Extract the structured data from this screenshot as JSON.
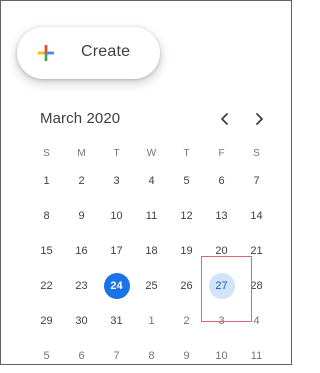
{
  "create_button": {
    "label": "Create",
    "icon": "plus-icon"
  },
  "mini_calendar": {
    "month_label": "March 2020",
    "prev_icon": "chevron-left-icon",
    "next_icon": "chevron-right-icon",
    "weekdays": [
      "S",
      "M",
      "T",
      "W",
      "T",
      "F",
      "S"
    ],
    "weeks": [
      [
        {
          "d": "1"
        },
        {
          "d": "2"
        },
        {
          "d": "3"
        },
        {
          "d": "4"
        },
        {
          "d": "5"
        },
        {
          "d": "6"
        },
        {
          "d": "7"
        }
      ],
      [
        {
          "d": "8"
        },
        {
          "d": "9"
        },
        {
          "d": "10"
        },
        {
          "d": "11"
        },
        {
          "d": "12"
        },
        {
          "d": "13"
        },
        {
          "d": "14"
        }
      ],
      [
        {
          "d": "15"
        },
        {
          "d": "16"
        },
        {
          "d": "17"
        },
        {
          "d": "18"
        },
        {
          "d": "19"
        },
        {
          "d": "20"
        },
        {
          "d": "21"
        }
      ],
      [
        {
          "d": "22"
        },
        {
          "d": "23"
        },
        {
          "d": "24",
          "state": "today"
        },
        {
          "d": "25"
        },
        {
          "d": "26"
        },
        {
          "d": "27",
          "state": "selected"
        },
        {
          "d": "28"
        }
      ],
      [
        {
          "d": "29"
        },
        {
          "d": "30"
        },
        {
          "d": "31"
        },
        {
          "d": "1",
          "other": true
        },
        {
          "d": "2",
          "other": true
        },
        {
          "d": "3",
          "other": true
        },
        {
          "d": "4",
          "other": true
        }
      ],
      [
        {
          "d": "5",
          "other": true
        },
        {
          "d": "6",
          "other": true
        },
        {
          "d": "7",
          "other": true
        },
        {
          "d": "8",
          "other": true
        },
        {
          "d": "9",
          "other": true
        },
        {
          "d": "10",
          "other": true
        },
        {
          "d": "11",
          "other": true
        }
      ]
    ]
  },
  "colors": {
    "today_bg": "#1a73e8",
    "selected_bg": "#d2e3fc",
    "highlight_outline": "#d66a73"
  }
}
